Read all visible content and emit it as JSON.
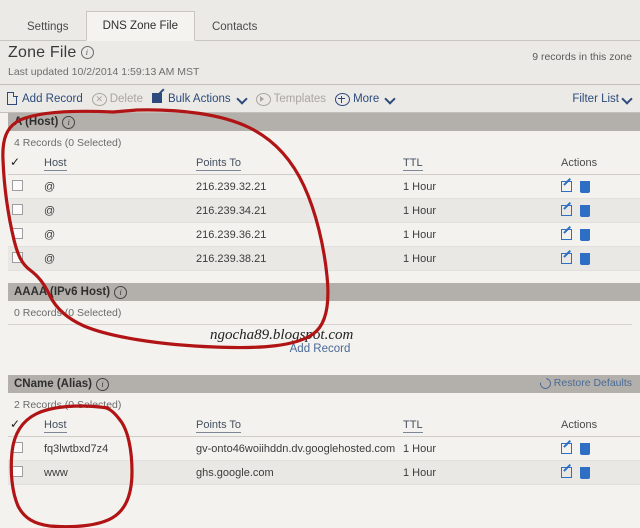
{
  "tabs": [
    {
      "label": "Settings",
      "active": false
    },
    {
      "label": "DNS Zone File",
      "active": true
    },
    {
      "label": "Contacts",
      "active": false
    }
  ],
  "header": {
    "title": "Zone File",
    "last_updated": "Last updated 10/2/2014 1:59:13 AM MST",
    "record_count": "9 records in this zone"
  },
  "toolbar": {
    "add_record": "Add Record",
    "delete": "Delete",
    "bulk_actions": "Bulk Actions",
    "templates": "Templates",
    "more": "More",
    "filter_list": "Filter List",
    "icons": {
      "add_record": "page-add-icon",
      "delete": "circle-x-icon",
      "bulk_actions": "pencil-square-icon",
      "templates": "circle-play-icon",
      "more": "circle-plus-icon",
      "chevron": "chevron-down-icon"
    }
  },
  "columns": {
    "host": "Host",
    "points_to": "Points To",
    "ttl": "TTL",
    "actions": "Actions"
  },
  "sections": [
    {
      "title": "A (Host)",
      "subtitle": "4 Records (0 Selected)",
      "has_table": true,
      "restore_defaults": null,
      "rows": [
        {
          "host": "@",
          "points_to": "216.239.32.21",
          "ttl": "1 Hour"
        },
        {
          "host": "@",
          "points_to": "216.239.34.21",
          "ttl": "1 Hour"
        },
        {
          "host": "@",
          "points_to": "216.239.36.21",
          "ttl": "1 Hour"
        },
        {
          "host": "@",
          "points_to": "216.239.38.21",
          "ttl": "1 Hour"
        }
      ]
    },
    {
      "title": "AAAA (IPv6 Host)",
      "subtitle": "0 Records (0 Selected)",
      "has_table": false,
      "restore_defaults": null,
      "add_record_label": "Add Record",
      "rows": []
    },
    {
      "title": "CName (Alias)",
      "subtitle": "2 Records (0 Selected)",
      "has_table": true,
      "restore_defaults": "Restore Defaults",
      "rows": [
        {
          "host": "fq3lwtbxd7z4",
          "points_to": "gv-onto46woiihddn.dv.googlehosted.com",
          "ttl": "1 Hour"
        },
        {
          "host": "www",
          "points_to": "ghs.google.com",
          "ttl": "1 Hour"
        }
      ]
    }
  ],
  "watermark": "ngocha89.blogspot.com",
  "annotation": {
    "color": "#b01414",
    "shapes": "two hand-drawn red circles"
  },
  "colors": {
    "page_background": "#eceae6",
    "content_background": "#f3f2ef",
    "section_header": "#b3b0ab",
    "link": "#2c4b7c",
    "action_icon": "#2c6fc4",
    "disabled": "#a9a6a1",
    "annotation_red": "#b01414"
  }
}
